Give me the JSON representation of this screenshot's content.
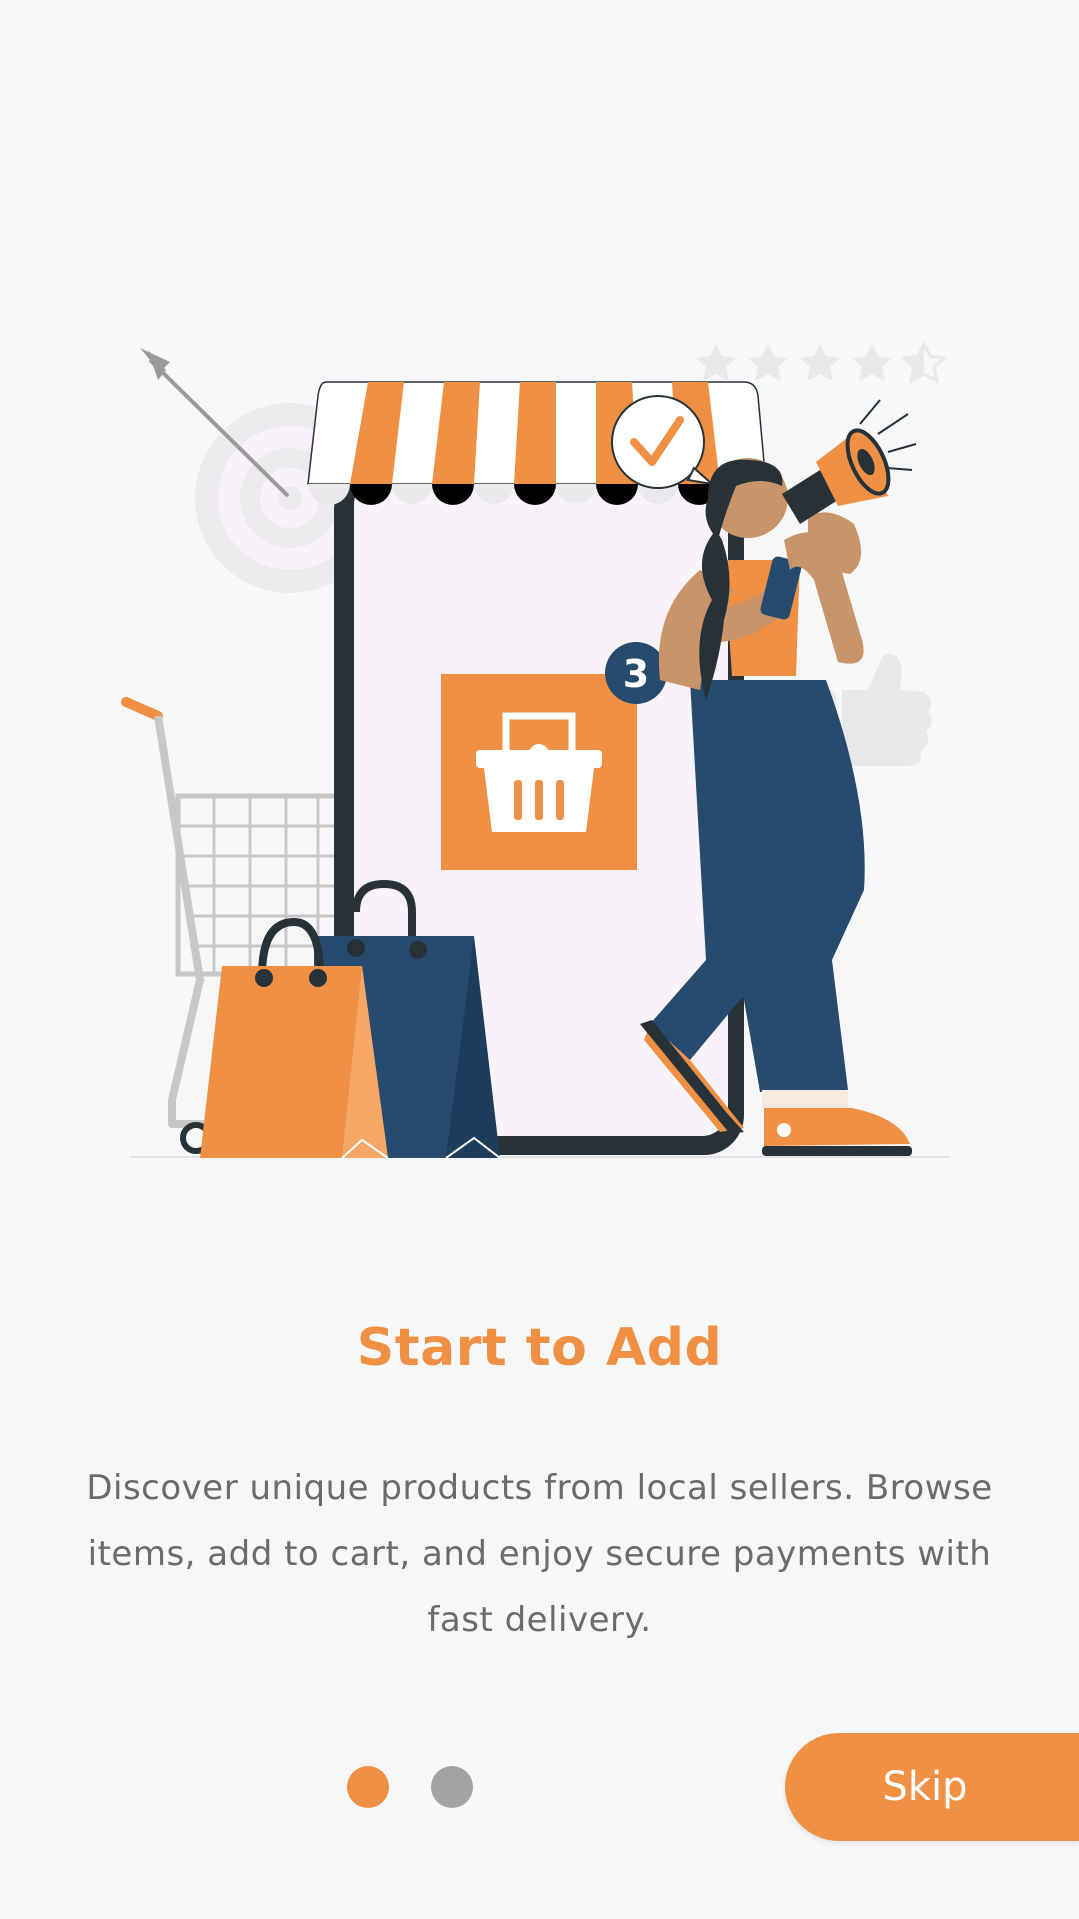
{
  "onboarding": {
    "title": "Start to Add",
    "description": "Discover unique products from local sellers. Browse items, add to cart, and enjoy secure payments with fast delivery.",
    "skip_label": "Skip",
    "page_count": 2,
    "current_page": 1,
    "illustration": {
      "badge_count": "3",
      "rating_stars": 5
    }
  },
  "colors": {
    "accent": "#f09044",
    "navy": "#264b6f",
    "dot_inactive": "#a3a3a3",
    "text_muted": "#6b6b6b",
    "background": "#f7f7f9"
  },
  "icons": {
    "basket": "basket-icon",
    "check": "checkmark-icon",
    "star": "star-icon",
    "thumbs_up": "thumbs-up-icon",
    "megaphone": "megaphone-icon",
    "cart": "shopping-cart-icon",
    "target": "target-icon"
  }
}
